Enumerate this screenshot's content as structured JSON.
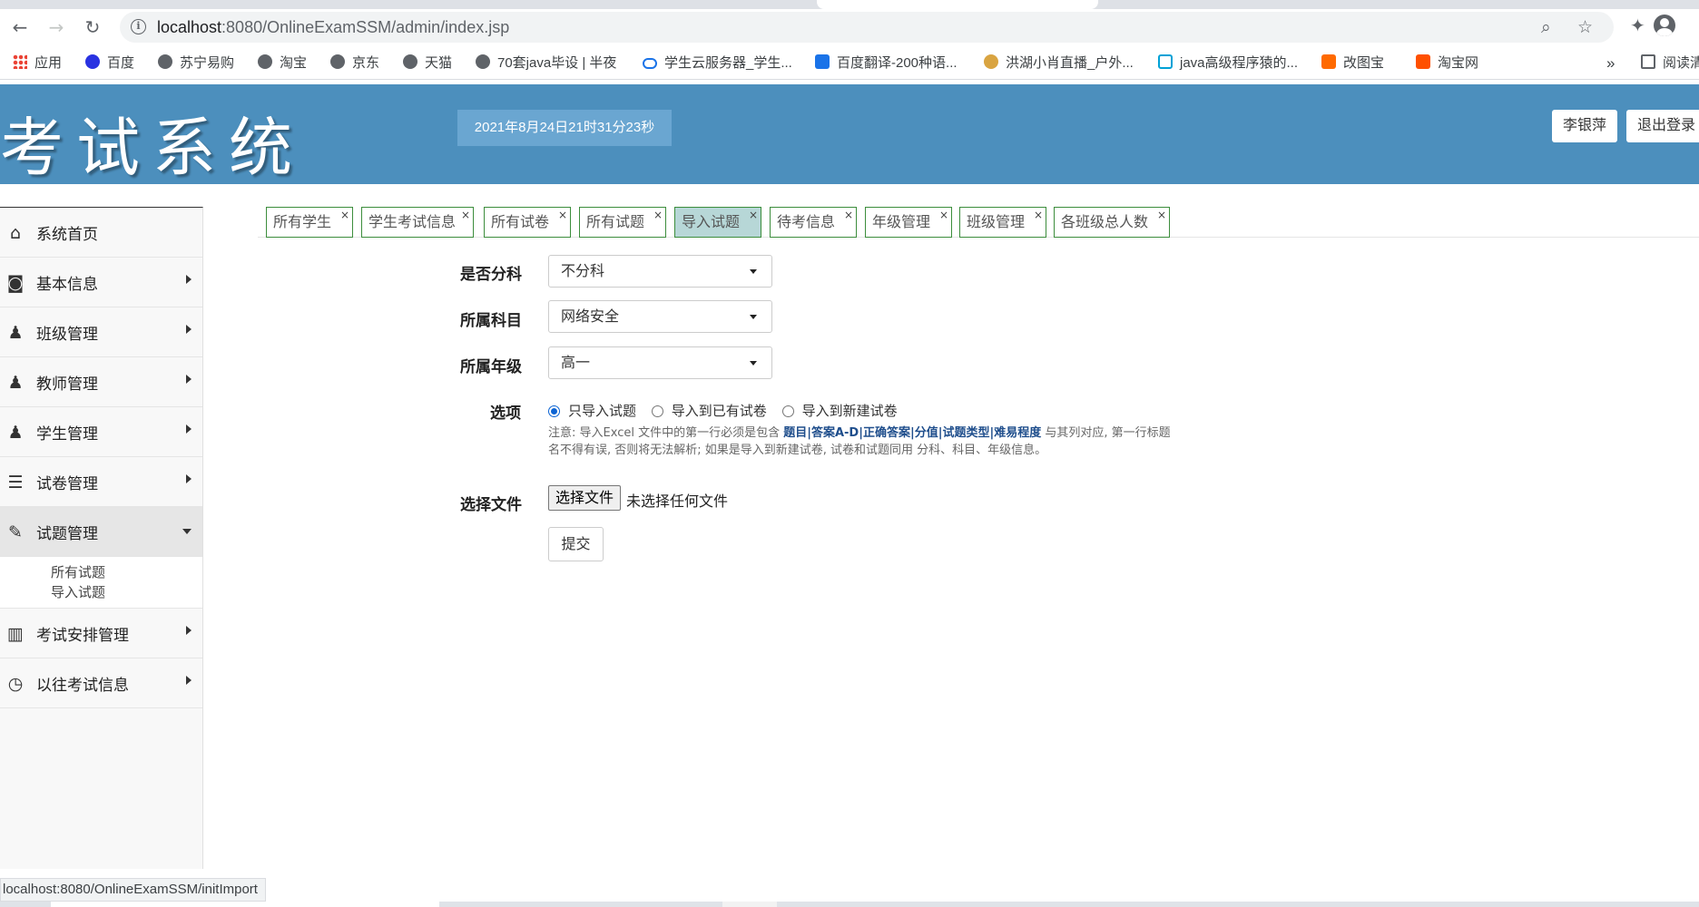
{
  "browser": {
    "url_host": "localhost",
    "url_rest": ":8080/OnlineExamSSM/admin/index.jsp",
    "bookmarks": [
      {
        "label": "应用",
        "icon": "apps-icon"
      },
      {
        "label": "百度",
        "icon": "baidu-icon"
      },
      {
        "label": "苏宁易购",
        "icon": "globe-icon"
      },
      {
        "label": "淘宝",
        "icon": "globe-icon"
      },
      {
        "label": "京东",
        "icon": "globe-icon"
      },
      {
        "label": "天猫",
        "icon": "globe-icon"
      },
      {
        "label": "70套java毕设 | 半夜",
        "icon": "globe-icon"
      },
      {
        "label": "学生云服务器_学生...",
        "icon": "cloud-icon"
      },
      {
        "label": "百度翻译-200种语...",
        "icon": "translate-icon"
      },
      {
        "label": "洪湖小肖直播_户外...",
        "icon": "bird-icon"
      },
      {
        "label": "java高级程序猿的...",
        "icon": "bilibili-icon"
      },
      {
        "label": "改图宝",
        "icon": "gaitubao-icon"
      },
      {
        "label": "淘宝网",
        "icon": "taobao-icon"
      }
    ],
    "more_label": "»",
    "reading_list_label": "阅读清"
  },
  "header": {
    "logo_text": "考试系统",
    "datetime": "2021年8月24日21时31分23秒",
    "user_name": "李银萍",
    "logout_label": "退出登录"
  },
  "sidebar": {
    "items": [
      {
        "label": "系统首页",
        "icon": "home-icon",
        "has_arrow": false
      },
      {
        "label": "基本信息",
        "icon": "monitor-icon",
        "has_arrow": true
      },
      {
        "label": "班级管理",
        "icon": "class-icon",
        "has_arrow": true
      },
      {
        "label": "教师管理",
        "icon": "teacher-icon",
        "has_arrow": true
      },
      {
        "label": "学生管理",
        "icon": "student-icon",
        "has_arrow": true
      },
      {
        "label": "试卷管理",
        "icon": "paper-icon",
        "has_arrow": true
      },
      {
        "label": "试题管理",
        "icon": "question-icon",
        "has_arrow": true,
        "expanded": true
      },
      {
        "label": "考试安排管理",
        "icon": "books-icon",
        "has_arrow": true
      },
      {
        "label": "以往考试信息",
        "icon": "clock-icon",
        "has_arrow": true
      }
    ],
    "submenu": [
      "所有试题",
      "导入试题"
    ]
  },
  "tabs": [
    {
      "label": "所有学生",
      "active": false
    },
    {
      "label": "学生考试信息",
      "active": false
    },
    {
      "label": "所有试卷",
      "active": false
    },
    {
      "label": "所有试题",
      "active": false
    },
    {
      "label": "导入试题",
      "active": true
    },
    {
      "label": "待考信息",
      "active": false
    },
    {
      "label": "年级管理",
      "active": false
    },
    {
      "label": "班级管理",
      "active": false
    },
    {
      "label": "各班级总人数",
      "active": false
    }
  ],
  "tab_close": "×",
  "form": {
    "split_label": "是否分科",
    "split_value": "不分科",
    "subject_label": "所属科目",
    "subject_value": "网络安全",
    "grade_label": "所属年级",
    "grade_value": "高一",
    "options_label": "选项",
    "options": [
      {
        "label": "只导入试题",
        "checked": true
      },
      {
        "label": "导入到已有试卷",
        "checked": false
      },
      {
        "label": "导入到新建试卷",
        "checked": false
      }
    ],
    "note_prefix": "注意: 导入Excel 文件中的第一行必须是包含 ",
    "note_fields": "题目|答案A-D|正确答案|分值|试题类型|难易程度",
    "note_suffix": " 与其列对应, 第一行标题名不得有误, 否则将无法解析; 如果是导入到新建试卷, 试卷和试题同用 分科、科目、年级信息。",
    "file_label": "选择文件",
    "file_button": "选择文件",
    "file_status": "未选择任何文件",
    "submit_label": "提交"
  },
  "status_bar": {
    "link": "localhost:8080/OnlineExamSSM/initImport"
  },
  "colors": {
    "header_bg": "#4c8fbd",
    "tab_border": "#3c8d3c",
    "active_tab_bg": "#b7d7d7"
  }
}
